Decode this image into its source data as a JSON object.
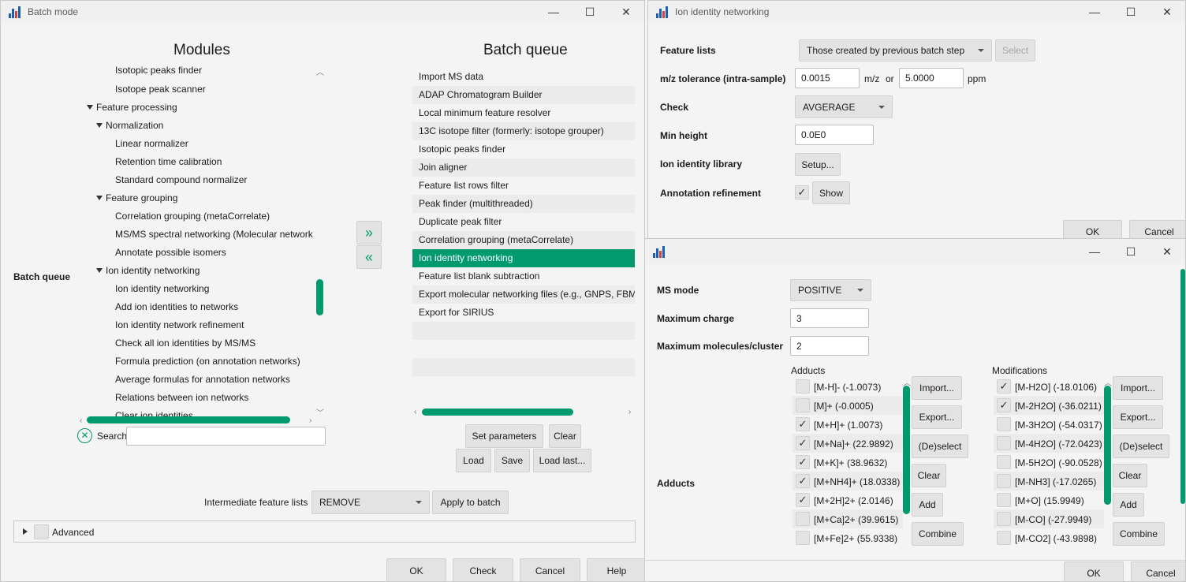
{
  "batch_window": {
    "title": "Batch mode",
    "modules_heading": "Modules",
    "queue_heading": "Batch queue",
    "side_label": "Batch queue",
    "tree": [
      {
        "label": "Isotopic peaks finder"
      },
      {
        "label": "Isotope peak scanner"
      },
      {
        "label": "Feature processing"
      },
      {
        "label": "Normalization"
      },
      {
        "label": "Linear normalizer"
      },
      {
        "label": "Retention time calibration"
      },
      {
        "label": "Standard compound normalizer"
      },
      {
        "label": "Feature grouping"
      },
      {
        "label": "Correlation grouping (metaCorrelate)"
      },
      {
        "label": "MS/MS spectral networking (Molecular network"
      },
      {
        "label": "Annotate possible isomers"
      },
      {
        "label": "Ion identity networking"
      },
      {
        "label": "Ion identity networking"
      },
      {
        "label": "Add ion identities to networks"
      },
      {
        "label": "Ion identity network refinement"
      },
      {
        "label": "Check all ion identities by MS/MS"
      },
      {
        "label": "Formula prediction (on annotation networks)"
      },
      {
        "label": "Average formulas for annotation networks"
      },
      {
        "label": "Relations between ion networks"
      },
      {
        "label": "Clear ion identities"
      }
    ],
    "queue": [
      "Import MS data",
      "ADAP Chromatogram Builder",
      "Local minimum feature resolver",
      "13C isotope filter (formerly: isotope grouper)",
      "Isotopic peaks finder",
      "Join aligner",
      "Feature list rows filter",
      "Peak finder (multithreaded)",
      "Duplicate peak filter",
      "Correlation grouping (metaCorrelate)",
      "Ion identity networking",
      "Feature list blank subtraction",
      "Export molecular networking files (e.g., GNPS, FBMN",
      "Export for SIRIUS"
    ],
    "selected_queue_index": 10,
    "add_arrow": "»",
    "remove_arrow": "«",
    "search_label": "Search",
    "search_value": "",
    "buttons": {
      "set_parameters": "Set parameters",
      "clear": "Clear",
      "load": "Load",
      "save": "Save",
      "load_last": "Load last..."
    },
    "intermediate_label": "Intermediate feature lists",
    "intermediate_value": "REMOVE",
    "apply_to_batch": "Apply to batch",
    "advanced_label": "Advanced",
    "footer": {
      "ok": "OK",
      "check": "Check",
      "cancel": "Cancel",
      "help": "Help"
    }
  },
  "ion_window": {
    "title": "Ion identity networking",
    "feature_lists_label": "Feature lists",
    "feature_lists_value": "Those created by previous batch step",
    "select_button": "Select",
    "mz_label": "m/z tolerance (intra-sample)",
    "mz_value": "0.0015",
    "mz_unit": "m/z",
    "or_text": "or",
    "ppm_value": "5.0000",
    "ppm_unit": "ppm",
    "check_label": "Check",
    "check_value": "AVGERAGE",
    "min_height_label": "Min height",
    "min_height_value": "0.0E0",
    "library_label": "Ion identity library",
    "setup_button": "Setup...",
    "refinement_label": "Annotation refinement",
    "refinement_checked": true,
    "show_button": "Show",
    "ok": "OK",
    "cancel": "Cancel"
  },
  "setup_window": {
    "title": "",
    "ms_mode_label": "MS mode",
    "ms_mode_value": "POSITIVE",
    "max_charge_label": "Maximum charge",
    "max_charge_value": "3",
    "max_molecules_label": "Maximum molecules/cluster",
    "max_molecules_value": "2",
    "adducts_label": "Adducts",
    "adducts_heading": "Adducts",
    "modifications_heading": "Modifications",
    "adducts": [
      {
        "label": "[M-H]- (-1.0073)",
        "checked": false
      },
      {
        "label": "[M]+ (-0.0005)",
        "checked": false
      },
      {
        "label": "[M+H]+ (1.0073)",
        "checked": true
      },
      {
        "label": "[M+Na]+ (22.9892)",
        "checked": true
      },
      {
        "label": "[M+K]+ (38.9632)",
        "checked": true
      },
      {
        "label": "[M+NH4]+ (18.0338)",
        "checked": true
      },
      {
        "label": "[M+2H]2+ (2.0146)",
        "checked": true
      },
      {
        "label": "[M+Ca]2+ (39.9615)",
        "checked": false
      },
      {
        "label": "[M+Fe]2+ (55.9338)",
        "checked": false
      }
    ],
    "modifications": [
      {
        "label": "[M-H2O] (-18.0106)",
        "checked": true
      },
      {
        "label": "[M-2H2O] (-36.0211)",
        "checked": true
      },
      {
        "label": "[M-3H2O] (-54.0317)",
        "checked": false
      },
      {
        "label": "[M-4H2O] (-72.0423)",
        "checked": false
      },
      {
        "label": "[M-5H2O] (-90.0528)",
        "checked": false
      },
      {
        "label": "[M-NH3] (-17.0265)",
        "checked": false
      },
      {
        "label": "[M+O] (15.9949)",
        "checked": false
      },
      {
        "label": "[M-CO] (-27.9949)",
        "checked": false
      },
      {
        "label": "[M-CO2] (-43.9898)",
        "checked": false
      }
    ],
    "list_buttons": [
      "Import...",
      "Export...",
      "(De)select",
      "Clear",
      "Add",
      "Combine"
    ],
    "ok": "OK",
    "cancel": "Cancel"
  },
  "icons": {
    "minimize": "minimize-icon",
    "maximize": "maximize-icon",
    "close": "close-icon"
  },
  "colors": {
    "accent": "#009a6e",
    "window_bg": "#f4f4f4",
    "button_bg": "#e3e3e3"
  }
}
